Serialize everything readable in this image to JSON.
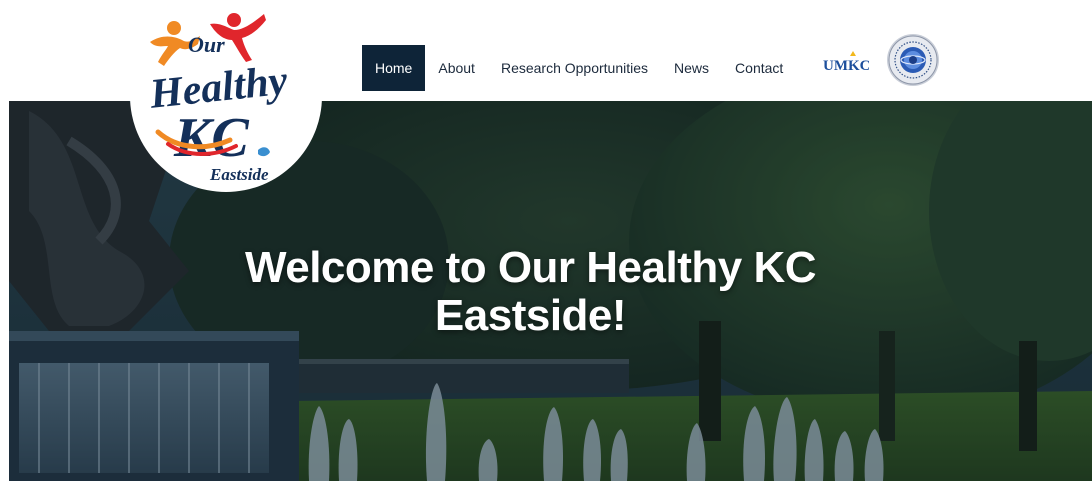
{
  "header": {
    "logo_alt": "Our Healthy KC Eastside",
    "logo": {
      "line1": "Our",
      "line2": "Healthy",
      "line3": "KC",
      "line4": "Eastside"
    },
    "nav": [
      {
        "label": "Home",
        "active": true
      },
      {
        "label": "About",
        "active": false
      },
      {
        "label": "Research Opportunities",
        "active": false
      },
      {
        "label": "News",
        "active": false
      },
      {
        "label": "Contact",
        "active": false
      }
    ],
    "partner_umkc": "UMKC"
  },
  "hero": {
    "title_line1": "Welcome to Our Healthy KC",
    "title_line2": "Eastside!"
  },
  "colors": {
    "nav_active_bg": "#0e2438",
    "nav_text": "#1c2a3c",
    "logo_navy": "#14305a",
    "logo_orange": "#f08a24",
    "logo_red": "#e0262c",
    "umkc_blue": "#1d4f9c",
    "umkc_gold": "#f2b81c"
  }
}
